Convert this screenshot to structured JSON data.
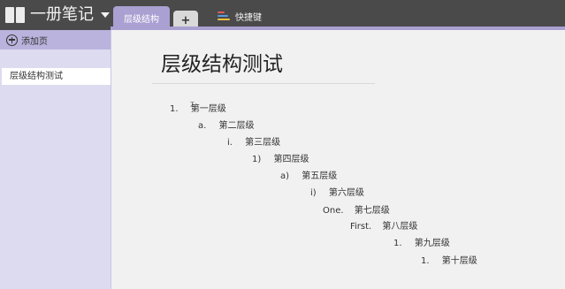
{
  "app": {
    "notebook_title": "一册笔记",
    "tabs": [
      {
        "label": "层级结构"
      }
    ],
    "add_tab_label": "+",
    "shortcut_label": "快捷键"
  },
  "sidebar": {
    "add_page_label": "添加页",
    "pages": [
      {
        "label": "层级结构测试"
      }
    ]
  },
  "page": {
    "title": "层级结构测试",
    "list": [
      {
        "marker": "1.",
        "text": "第一层级"
      },
      {
        "marker": "a.",
        "text": "第二层级"
      },
      {
        "marker": "i.",
        "text": "第三层级"
      },
      {
        "marker": "1)",
        "text": "第四层级"
      },
      {
        "marker": "a)",
        "text": "第五层级"
      },
      {
        "marker": "i)",
        "text": "第六层级"
      },
      {
        "marker": "One.",
        "text": "第七层级"
      },
      {
        "marker": "First.",
        "text": "第八层级"
      },
      {
        "marker": "1.",
        "text": "第九层级"
      },
      {
        "marker": "1.",
        "text": "第十层级"
      }
    ]
  },
  "colors": {
    "topbar": "#4a4a4a",
    "accent": "#aaa1d2",
    "sidebar": "#dddbf0"
  },
  "icons": {
    "notebook": "book-icon",
    "add_page": "plus-circle-icon",
    "shortcut": "keyboard-icon"
  }
}
